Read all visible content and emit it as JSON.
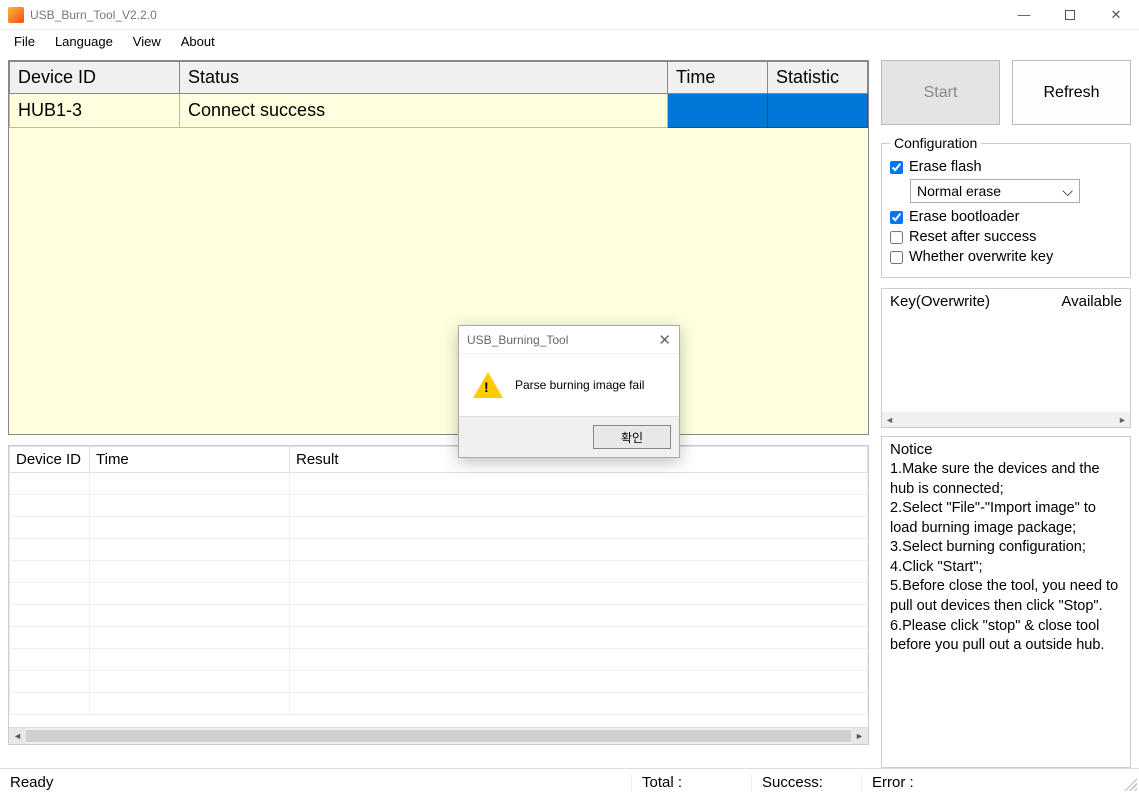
{
  "window": {
    "title": "USB_Burn_Tool_V2.2.0"
  },
  "menu": {
    "file": "File",
    "language": "Language",
    "view": "View",
    "about": "About"
  },
  "dev_table": {
    "headers": {
      "id": "Device ID",
      "status": "Status",
      "time": "Time",
      "statistic": "Statistic"
    },
    "rows": [
      {
        "id": "HUB1-3",
        "status": "Connect success",
        "time": "",
        "statistic": ""
      }
    ]
  },
  "res_table": {
    "headers": {
      "id": "Device ID",
      "time": "Time",
      "result": "Result"
    }
  },
  "buttons": {
    "start": "Start",
    "refresh": "Refresh"
  },
  "config": {
    "legend": "Configuration",
    "erase_flash_label": "Erase flash",
    "erase_flash_checked": true,
    "erase_mode": "Normal erase",
    "erase_bootloader_label": "Erase bootloader",
    "erase_bootloader_checked": true,
    "reset_label": "Reset after success",
    "reset_checked": false,
    "overwrite_label": "Whether overwrite key",
    "overwrite_checked": false
  },
  "key_panel": {
    "col1": "Key(Overwrite)",
    "col2": "Available"
  },
  "notice": {
    "title": "Notice",
    "lines": [
      "1.Make sure the devices and the hub is connected;",
      "2.Select \"File\"-\"Import image\" to load burning image package;",
      "3.Select burning configuration;",
      "4.Click \"Start\";",
      "5.Before close the tool, you need to pull out devices then click \"Stop\".",
      "6.Please click \"stop\" & close tool before you pull out a outside hub."
    ]
  },
  "statusbar": {
    "ready": "Ready",
    "total": "Total :",
    "success": "Success:",
    "error": "Error :"
  },
  "modal": {
    "title": "USB_Burning_Tool",
    "message": "Parse burning image fail",
    "ok": "확인"
  }
}
